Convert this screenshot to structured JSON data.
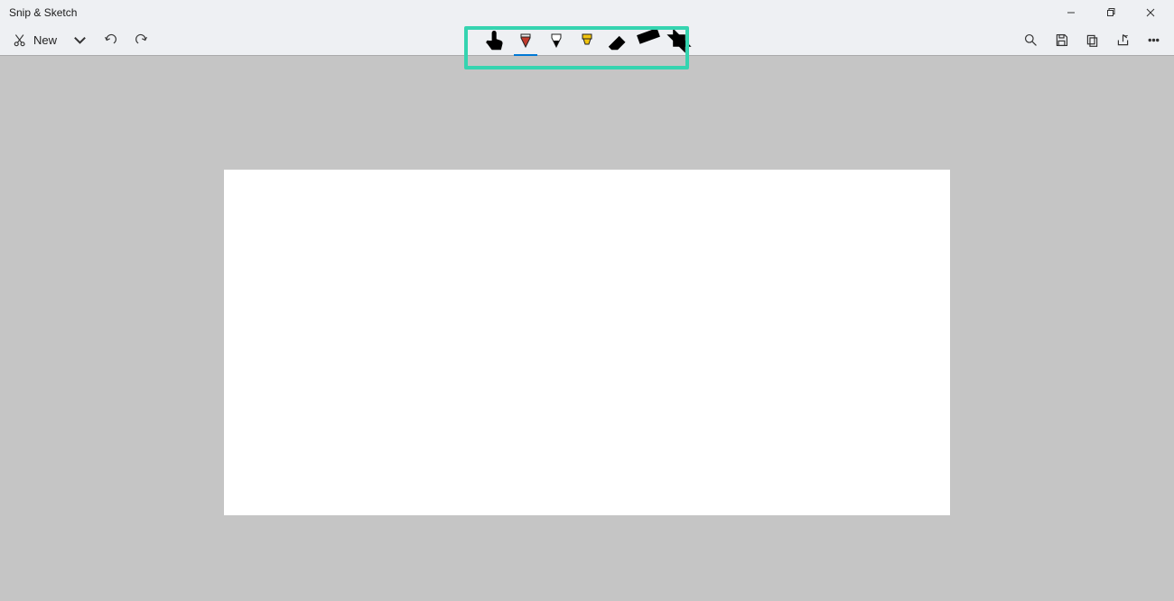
{
  "titlebar": {
    "title": "Snip & Sketch"
  },
  "toolbar": {
    "new_label": "New"
  },
  "tools": {
    "touch": "touch-writing",
    "ballpoint": "ballpoint-pen",
    "pencil": "pencil-tool",
    "highlighter": "highlighter",
    "eraser": "eraser",
    "ruler": "ruler",
    "crop": "crop"
  },
  "colors": {
    "ballpoint": "#c0392b",
    "pencil": "#000000",
    "highlighter": "#f1c40f",
    "accent": "#0078d4",
    "highlight_box": "#35d4b0"
  }
}
